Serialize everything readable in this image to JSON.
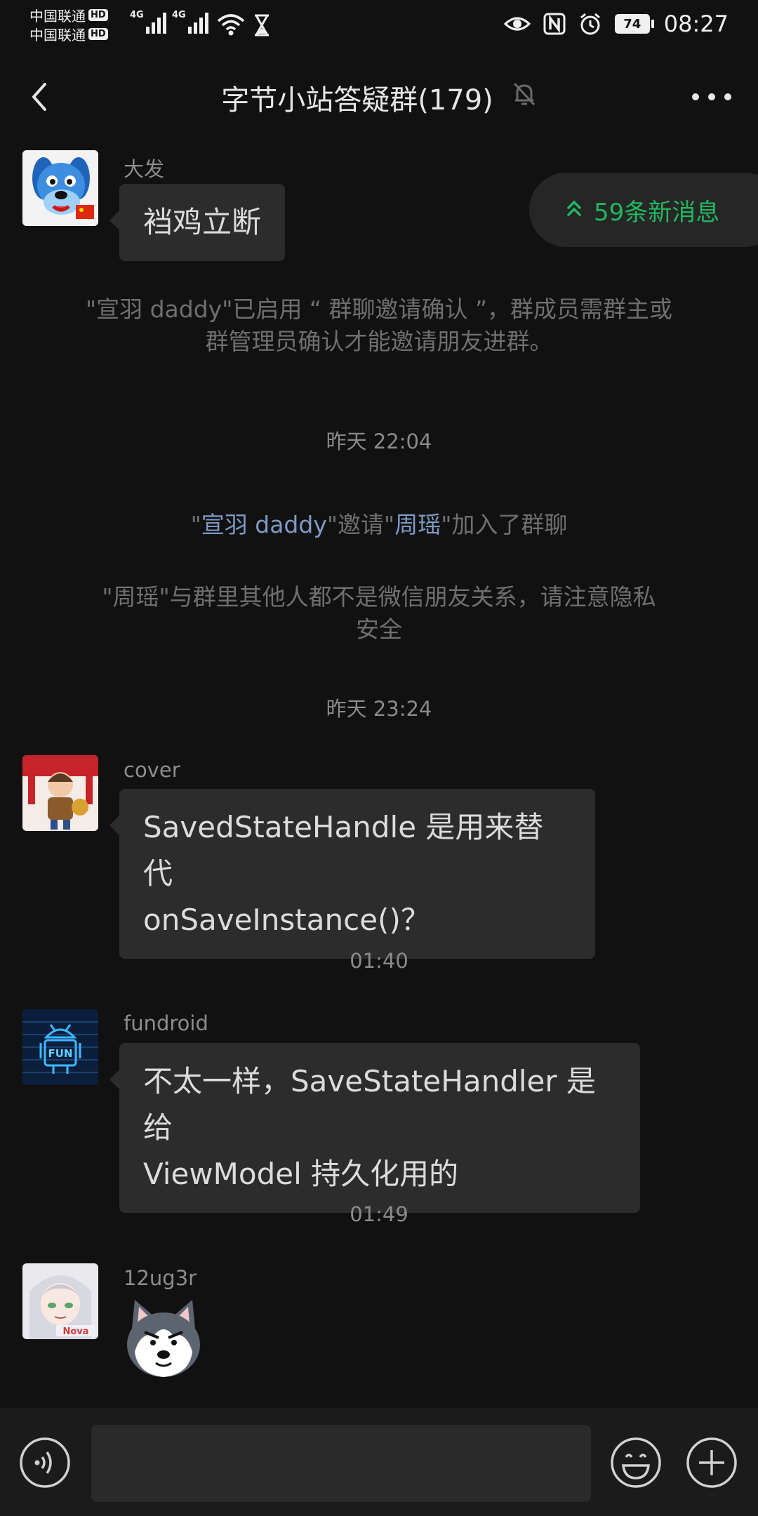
{
  "status_bar": {
    "carrier_1": "中国联通",
    "carrier_2": "中国联通",
    "hd_label": "HD",
    "network_1": "4G",
    "network_2": "4G",
    "battery": "74",
    "time": "08:27",
    "icons": [
      "eye-comfort-icon",
      "nfc-icon",
      "alarm-icon",
      "battery-icon",
      "wifi-icon",
      "hourglass-icon"
    ]
  },
  "header": {
    "title": "字节小站答疑群(179)",
    "icons": [
      "back-arrow-icon",
      "mute-bell-icon",
      "more-icon"
    ]
  },
  "new_messages": {
    "label": "59条新消息",
    "icon": "double-chevron-up-icon"
  },
  "messages": [
    {
      "sender": "大发",
      "text": "裆鸡立断",
      "accent": "#2f7fd0"
    },
    {
      "sender": "cover",
      "line1": "SavedStateHandle 是用来替代",
      "line2": "onSaveInstance()？"
    },
    {
      "sender": "fundroid",
      "line1": "不太一样，SaveStateHandler 是给",
      "line2": "ViewModel 持久化用的"
    },
    {
      "sender": "12ug3r"
    }
  ],
  "system": {
    "notice_line1": "\"宣羽 daddy\"已启用 “ 群聊邀请确认 ”，群成员需群主或",
    "notice_line2": "群管理员确认才能邀请朋友进群。",
    "time1": "昨天 22:04",
    "invite_q1": "\"",
    "invite_name1": "宣羽 daddy",
    "invite_q2": "\"邀请\"",
    "invite_name2": "周瑶",
    "invite_tail": "\"加入了群聊",
    "privacy_line1": "\"周瑶\"与群里其他人都不是微信朋友关系，请注意隐私",
    "privacy_line2": "安全",
    "time2": "昨天 23:24",
    "time3": "01:40",
    "time4": "01:49"
  },
  "input_bar": {
    "value": "",
    "icons": [
      "voice-icon",
      "emoji-icon",
      "plus-icon"
    ]
  },
  "colors": {
    "background": "#111111",
    "bubble": "#2c2c2c",
    "accent_green": "#21b85f",
    "link_blue": "#7e9ac4"
  }
}
